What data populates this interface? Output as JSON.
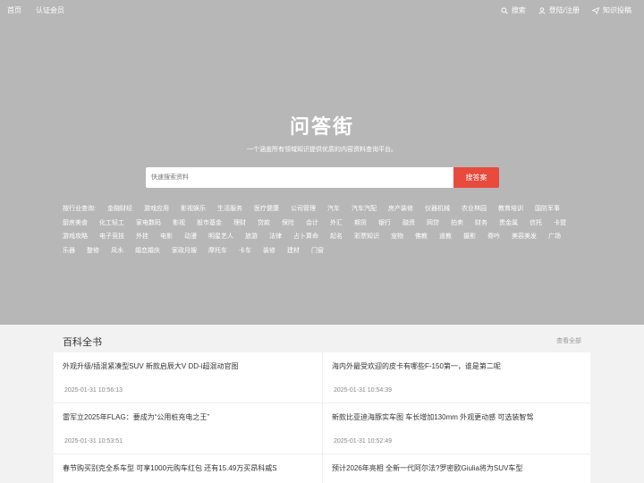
{
  "topbar": {
    "left": [
      "首页",
      "认证会员"
    ],
    "right": [
      {
        "label": "搜索",
        "icon": "search-icon"
      },
      {
        "label": "登陆/注册",
        "icon": "user-icon"
      },
      {
        "label": "知识投稿",
        "icon": "send-icon"
      }
    ]
  },
  "hero": {
    "title": "问答街",
    "subtitle": "一个涵盖所有领域知识提供优质的内容资料查询平台。",
    "search_placeholder": "快速搜索资料",
    "search_button": "搜答案"
  },
  "tags": [
    "按行业查询:",
    "金融财经",
    "游戏应用",
    "影视娱乐",
    "生活服务",
    "医疗健康",
    "公司管理",
    "汽车",
    "汽车汽配",
    "房产装修",
    "仪器机械",
    "农业林园",
    "教育培训",
    "国防军事",
    "厨房美食",
    "化工轻工",
    "家电数码",
    "影视",
    "股市基金",
    "理财",
    "贷款",
    "保险",
    "会计",
    "外汇",
    "期货",
    "银行",
    "融资",
    "网贷",
    "拍卖",
    "财务",
    "贵金属",
    "信托",
    "卡盟",
    "游戏攻略",
    "电子竞技",
    "外挂",
    "电影",
    "动漫",
    "明星艺人",
    "旅游",
    "法律",
    "占卜算命",
    "起名",
    "彩票知识",
    "宠物",
    "佛教",
    "道教",
    "摄影",
    "脊吟",
    "美容美发",
    "广场",
    "乐器",
    "整修",
    "风水",
    "婚恋婚庆",
    "家政月嫂",
    "摩托车",
    "卡车",
    "装修",
    "建材",
    "门窗"
  ],
  "section": {
    "title": "百科全书",
    "more": "查看全部",
    "articles": [
      {
        "title": "外观升级/插混紧凑型SUV 新款启辰大V DD-i超混动官图",
        "date": "2025-01-31 10:56:13"
      },
      {
        "title": "海内外最受欢迎的皮卡有哪些F-150第一，谁是第二呢",
        "date": "2025-01-31 10:54:39"
      },
      {
        "title": "雷军立2025年FLAG：要成为“公用桩充电之王”",
        "date": "2025-01-31 10:53:51"
      },
      {
        "title": "新款比亚迪海豚实车图 车长增加130mm 外观更动感 可选装智驾",
        "date": "2025-01-31 10:52:49"
      },
      {
        "title": "春节购买别克全系车型 可享1000元购车红包 还有15.49万买昂科威S",
        "date": ""
      },
      {
        "title": "预计2026年亮相 全新一代阿尔法?罗密欧Giulia将为SUV车型",
        "date": ""
      }
    ]
  }
}
